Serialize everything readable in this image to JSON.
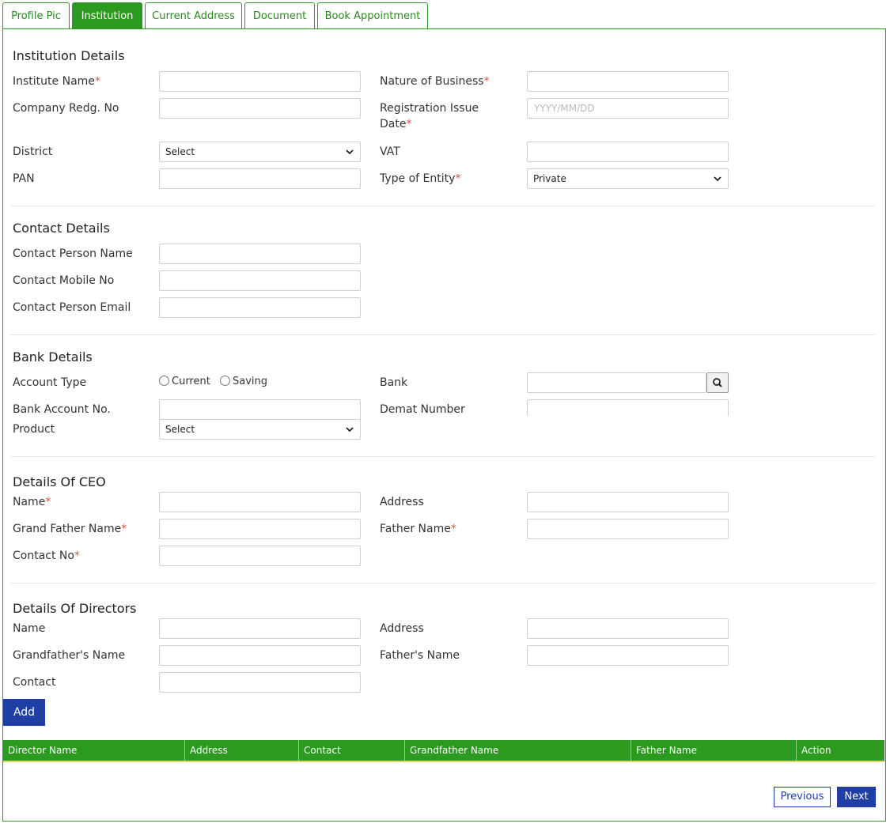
{
  "tabs": [
    {
      "label": "Profile Pic"
    },
    {
      "label": "Institution"
    },
    {
      "label": "Current Address"
    },
    {
      "label": "Document"
    },
    {
      "label": "Book Appointment"
    }
  ],
  "institution": {
    "title": "Institution Details",
    "institute_name": "Institute Name",
    "nature_of_business": "Nature of Business",
    "company_regd_no": "Company Redg. No",
    "registration_issue_date_1": "Registration Issue",
    "registration_issue_date_2": "Date",
    "date_placeholder": "YYYY/MM/DD",
    "district": "District",
    "district_value": "Select",
    "vat": "VAT",
    "pan": "PAN",
    "type_of_entity": "Type of Entity",
    "entity_value": "Private"
  },
  "contact": {
    "title": "Contact Details",
    "person_name": "Contact Person Name",
    "mobile_no": "Contact Mobile No",
    "email": "Contact Person Email"
  },
  "bank": {
    "title": "Bank Details",
    "account_type": "Account Type",
    "opt_current": "Current",
    "opt_saving": "Saving",
    "bank": "Bank",
    "account_no": "Bank Account No.",
    "demat": "Demat Number",
    "product": "Product",
    "product_value": "Select"
  },
  "ceo": {
    "title": "Details Of CEO",
    "name": "Name",
    "address": "Address",
    "grandfather": "Grand Father Name",
    "father": "Father Name",
    "contact": "Contact No"
  },
  "directors": {
    "title": "Details Of Directors",
    "name": "Name",
    "address": "Address",
    "grandfather": "Grandfather's Name",
    "father": "Father's Name",
    "contact": "Contact",
    "add_label": "Add",
    "columns": [
      "Director Name",
      "Address",
      "Contact",
      "Grandfather Name",
      "Father Name",
      "Action"
    ]
  },
  "required_mark": "*",
  "footer": {
    "previous": "Previous",
    "next": "Next"
  },
  "colors": {
    "accent_green": "#2b9a1e",
    "primary_blue": "#1f3fa5",
    "required_red": "#d9534f"
  }
}
